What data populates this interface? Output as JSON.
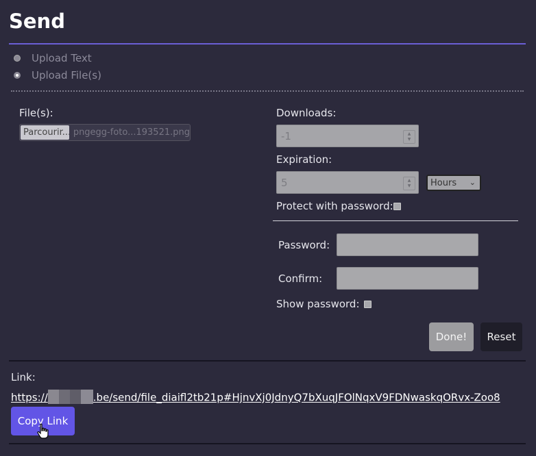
{
  "page": {
    "title": "Send"
  },
  "mode": {
    "options": [
      {
        "label": "Upload Text",
        "checked": false
      },
      {
        "label": "Upload File(s)",
        "checked": true
      }
    ]
  },
  "files": {
    "label": "File(s):",
    "browse_label": "Parcourir...",
    "file_name": "pngegg-foto...193521.png"
  },
  "downloads": {
    "label": "Downloads:",
    "value": "-1"
  },
  "expiration": {
    "label": "Expiration:",
    "value": "5",
    "unit_selected": "Hours"
  },
  "protect": {
    "label": "Protect with password:",
    "checked": false
  },
  "password": {
    "label": "Password:",
    "value": ""
  },
  "confirm": {
    "label": "Confirm:",
    "value": ""
  },
  "show_password": {
    "label": "Show password:",
    "checked": false
  },
  "buttons": {
    "done": "Done!",
    "reset": "Reset",
    "copy_link": "Copy Link"
  },
  "link": {
    "label": "Link:",
    "url_prefix": "https://",
    "url_rest": ".be/send/file_diaifl2tb21p#HjnvXj0JdnyQ7bXuqJFOlNqxV9FDNwaskqORvx-Zoo8"
  },
  "colors": {
    "accent": "#6255e6",
    "background": "#2c2a3c",
    "title_rule": "#6b5fd6"
  }
}
